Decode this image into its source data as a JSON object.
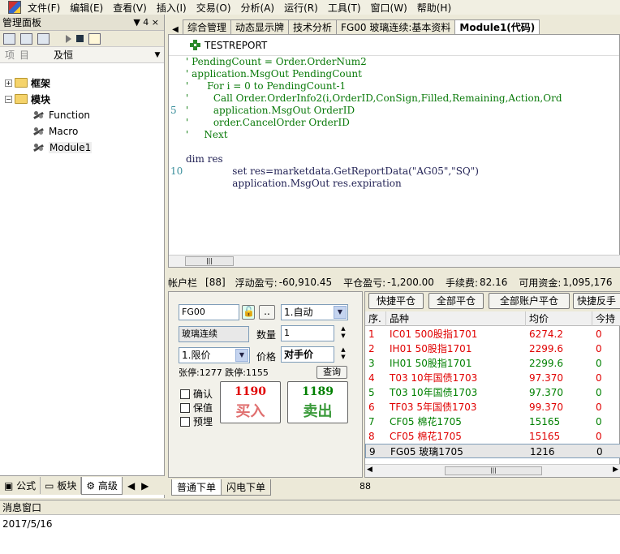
{
  "menu": [
    "文件(F)",
    "编辑(E)",
    "查看(V)",
    "插入(I)",
    "交易(O)",
    "分析(A)",
    "运行(R)",
    "工具(T)",
    "窗口(W)",
    "帮助(H)"
  ],
  "panel": {
    "title": "管理面板",
    "pin_label": "▼ 4 ×",
    "combo_label": "项目",
    "combo_value": "及恒",
    "tree": {
      "frame": "框架",
      "module": "模块",
      "children": [
        "Function",
        "Macro",
        "Module1"
      ]
    },
    "bottom_tabs": [
      "公式",
      "板块",
      "高级"
    ]
  },
  "doc_tabs": [
    "综合管理",
    "动态显示牌",
    "技术分析",
    "FG00 玻璃连续:基本资料",
    "Module1(代码)"
  ],
  "code": {
    "header": "TESTREPORT",
    "lines": [
      {
        "n": "",
        "t": "' PendingCount = Order.OrderNum2",
        "style": "cm"
      },
      {
        "n": "",
        "t": "' application.MsgOut PendingCount",
        "style": "cm"
      },
      {
        "n": "",
        "t": "'      For i = 0 to PendingCount-1",
        "style": "cm"
      },
      {
        "n": "",
        "t": "'        Call Order.OrderInfo2(i,OrderID,ConSign,Filled,Remaining,Action,Ord",
        "style": "cm"
      },
      {
        "n": "5",
        "t": "'        application.MsgOut OrderID",
        "style": "cm"
      },
      {
        "n": "",
        "t": "'        order.CancelOrder OrderID",
        "style": "cm"
      },
      {
        "n": "",
        "t": "'     Next",
        "style": "cm"
      },
      {
        "n": "",
        "t": "",
        "style": "blk"
      },
      {
        "n": "",
        "t": "dim res",
        "style": "blk"
      },
      {
        "n": "10",
        "t": "               set res=marketdata.GetReportData(\"AG05\",\"SQ\")",
        "style": "blk"
      },
      {
        "n": "",
        "t": "               application.MsgOut res.expiration",
        "style": "blk"
      }
    ]
  },
  "account": {
    "label": "帐户栏",
    "account_no": "[88]",
    "float_pl_label": "浮动盈亏:",
    "float_pl": "-60,910.45",
    "close_pl_label": "平仓盈亏:",
    "close_pl": "-1,200.00",
    "fee_label": "手续费:",
    "fee": "82.16",
    "avail_label": "可用资金:",
    "avail": "1,095,176"
  },
  "order": {
    "contract_code": "FG00",
    "dots": "..",
    "open_close": "1.自动",
    "contract_name": "玻璃连续",
    "qty_label": "数量",
    "qty": "1",
    "price_type": "1.限价",
    "price_label": "价格",
    "price_value": "对手价",
    "limit_info": "张停:1277 跌停:1155",
    "query_label": "查询",
    "checks": [
      "确认",
      "保值",
      "预埋"
    ],
    "buy_price": "1190",
    "buy_label": "买入",
    "sell_price": "1189",
    "sell_label": "卖出"
  },
  "grid": {
    "buttons": [
      "快捷平仓",
      "全部平仓",
      "全部账户平仓",
      "快捷反手"
    ],
    "headers": [
      "序.",
      "品种",
      "均价",
      "今持"
    ],
    "rows": [
      {
        "idx": "1",
        "name": "IC01 500股指1701",
        "avg": "6274.2",
        "hold": "0",
        "color": "red"
      },
      {
        "idx": "2",
        "name": "IH01 50股指1701",
        "avg": "2299.6",
        "hold": "0",
        "color": "red"
      },
      {
        "idx": "3",
        "name": "IH01 50股指1701",
        "avg": "2299.6",
        "hold": "0",
        "color": "green"
      },
      {
        "idx": "4",
        "name": "T03 10年国债1703",
        "avg": "97.370",
        "hold": "0",
        "color": "red"
      },
      {
        "idx": "5",
        "name": "T03 10年国债1703",
        "avg": "97.370",
        "hold": "0",
        "color": "green"
      },
      {
        "idx": "6",
        "name": "TF03 5年国债1703",
        "avg": "99.370",
        "hold": "0",
        "color": "red"
      },
      {
        "idx": "7",
        "name": "CF05 棉花1705",
        "avg": "15165",
        "hold": "0",
        "color": "green"
      },
      {
        "idx": "8",
        "name": "CF05 棉花1705",
        "avg": "15165",
        "hold": "0",
        "color": "red"
      },
      {
        "idx": "9",
        "name": "FG05 玻璃1705",
        "avg": "1216",
        "hold": "0",
        "color": "blk"
      }
    ]
  },
  "order_tabs": [
    "普通下单",
    "闪电下单"
  ],
  "order_tab_count": "88",
  "message": {
    "title": "消息窗口",
    "text": "2017/5/16"
  }
}
